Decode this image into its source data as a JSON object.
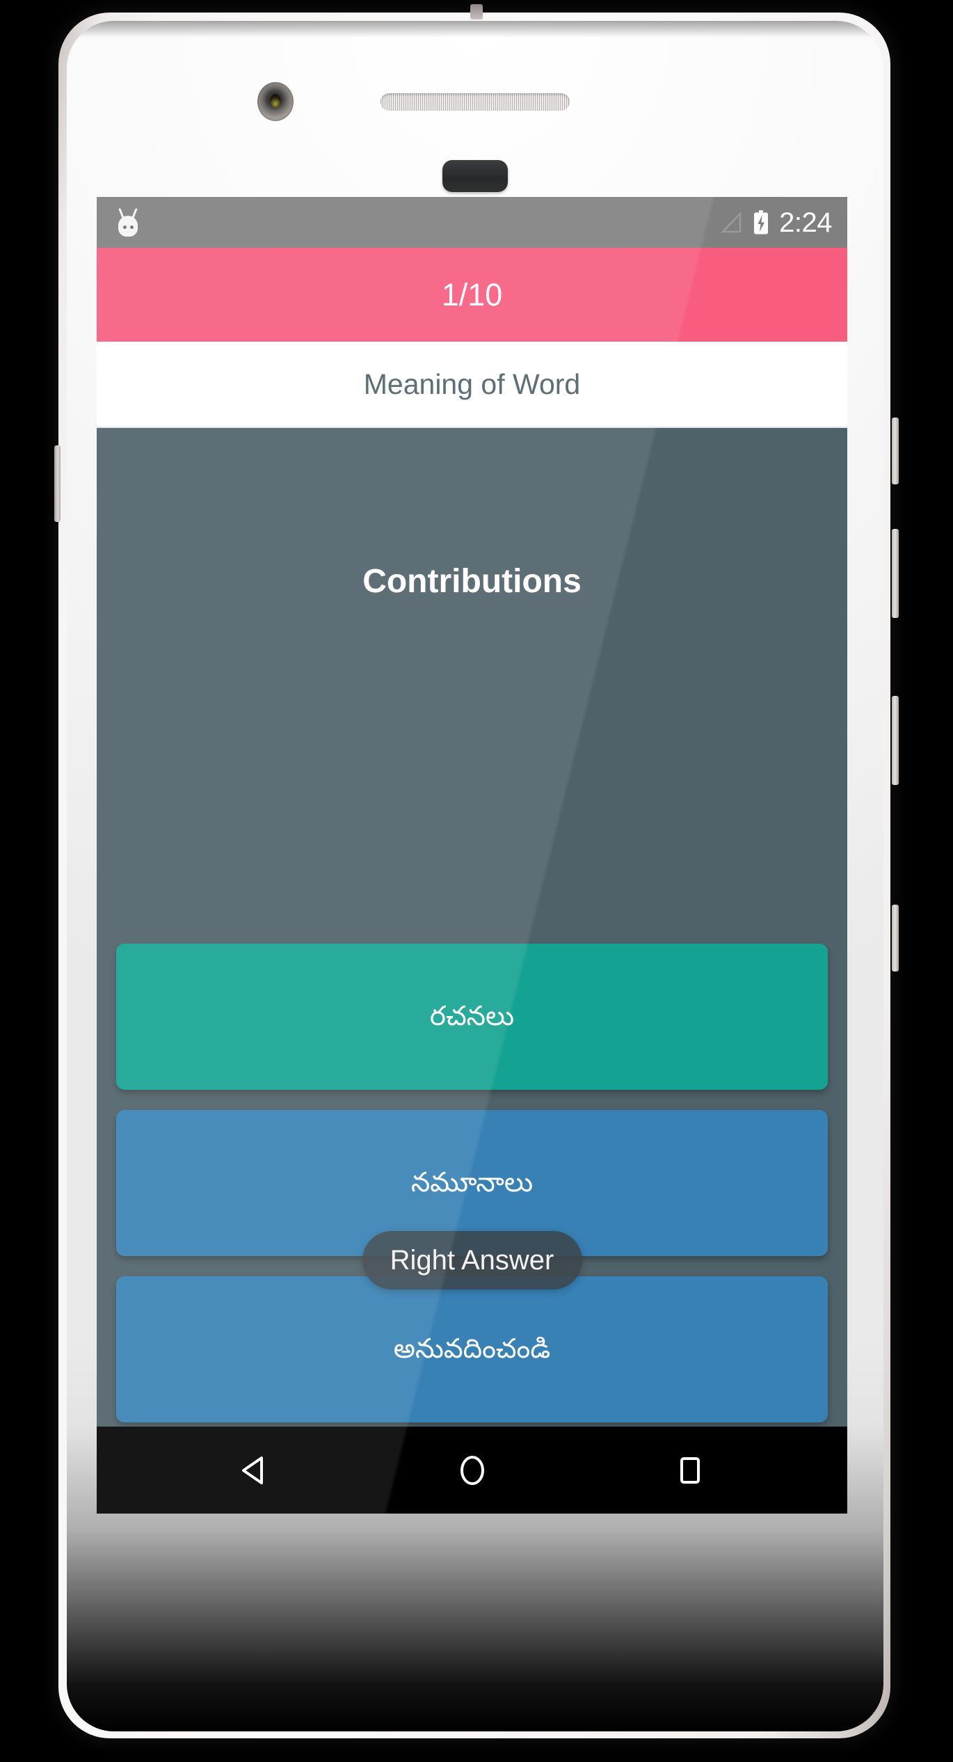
{
  "colors": {
    "accent_pink": "#F85C7F",
    "surface_dark": "#4F6169",
    "correct_green": "#14A392",
    "option_blue": "#3781B5",
    "status_bar_gray": "#808080",
    "nav_bar_black": "#000000",
    "question_text": "#4E6169",
    "toast_bg": "rgba(60,70,76,0.88)"
  },
  "status_bar": {
    "notification_icon": "android-robot-icon",
    "signal_icon": "signal-triangle-icon",
    "battery_icon": "battery-charging-icon",
    "time": "2:24"
  },
  "app_bar": {
    "progress_label": "1/10"
  },
  "question_header": {
    "prompt": "Meaning of Word"
  },
  "quiz": {
    "word": "Contributions",
    "options": [
      {
        "label": "రచనలు",
        "state": "correct"
      },
      {
        "label": "నమూనాలు",
        "state": "normal"
      },
      {
        "label": "అనువదించండి",
        "state": "normal"
      }
    ]
  },
  "toast": {
    "message": "Right Answer"
  },
  "nav_bar": {
    "back": "back-triangle-icon",
    "home": "home-circle-icon",
    "recents": "recents-square-icon"
  }
}
